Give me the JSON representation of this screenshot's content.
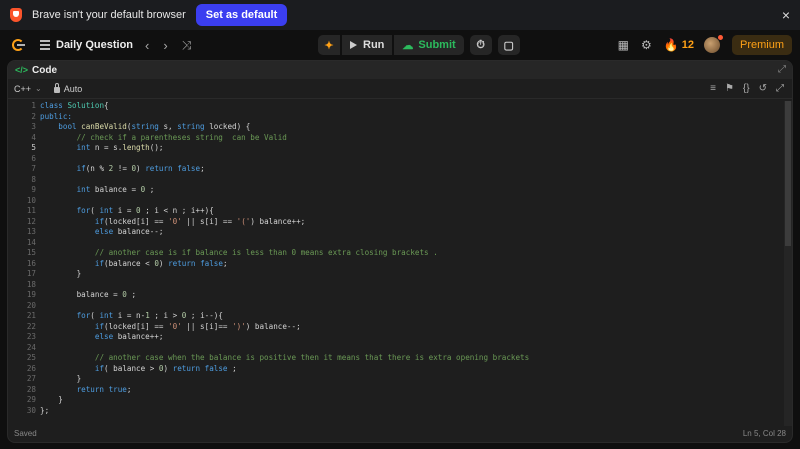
{
  "browser_bar": {
    "message": "Brave isn't your default browser",
    "set_default_label": "Set as default",
    "close": "×"
  },
  "nav": {
    "title": "Daily Question",
    "run_label": "Run",
    "submit_label": "Submit",
    "streak": "12",
    "premium_label": "Premium"
  },
  "editor": {
    "panel_title": "Code",
    "language": "C++",
    "mode": "Auto",
    "status_left": "Saved",
    "status_right": "Ln 5, Col 28",
    "active_line": 5,
    "lines": [
      [
        [
          "kw",
          "class "
        ],
        [
          "cls",
          "Solution"
        ],
        [
          "",
          "{"
        ]
      ],
      [
        [
          "kw",
          "public:"
        ]
      ],
      [
        [
          "",
          "    "
        ],
        [
          "kw",
          "bool "
        ],
        [
          "fn",
          "canBeValid"
        ],
        [
          "",
          "("
        ],
        [
          "kw",
          "string "
        ],
        [
          "",
          "s, "
        ],
        [
          "kw",
          "string "
        ],
        [
          "",
          "locked) {"
        ]
      ],
      [
        [
          "",
          "        "
        ],
        [
          "cm",
          "// check if a parentheses string  can be Valid"
        ]
      ],
      [
        [
          "",
          "        "
        ],
        [
          "kw",
          "int "
        ],
        [
          "",
          "n = s."
        ],
        [
          "fn",
          "length"
        ],
        [
          "",
          "();"
        ]
      ],
      [
        [
          "",
          ""
        ]
      ],
      [
        [
          "",
          "        "
        ],
        [
          "kw",
          "if"
        ],
        [
          "",
          "(n % "
        ],
        [
          "num",
          "2"
        ],
        [
          "",
          " != "
        ],
        [
          "num",
          "0"
        ],
        [
          "",
          ") "
        ],
        [
          "kw",
          "return false"
        ],
        [
          "",
          ";"
        ]
      ],
      [
        [
          "",
          ""
        ]
      ],
      [
        [
          "",
          "        "
        ],
        [
          "kw",
          "int "
        ],
        [
          "",
          "balance = "
        ],
        [
          "num",
          "0"
        ],
        [
          "",
          " ;"
        ]
      ],
      [
        [
          "",
          ""
        ]
      ],
      [
        [
          "",
          "        "
        ],
        [
          "kw",
          "for"
        ],
        [
          "",
          "( "
        ],
        [
          "kw",
          "int "
        ],
        [
          "",
          "i = "
        ],
        [
          "num",
          "0"
        ],
        [
          "",
          " ; i < n ; i++){"
        ]
      ],
      [
        [
          "",
          "            "
        ],
        [
          "kw",
          "if"
        ],
        [
          "",
          "(locked[i] == "
        ],
        [
          "str",
          "'0'"
        ],
        [
          "",
          " || s[i] == "
        ],
        [
          "str",
          "'('"
        ],
        [
          "",
          ") balance++;"
        ]
      ],
      [
        [
          "",
          "            "
        ],
        [
          "kw",
          "else "
        ],
        [
          "",
          "balance--;"
        ]
      ],
      [
        [
          "",
          ""
        ]
      ],
      [
        [
          "",
          "            "
        ],
        [
          "cm",
          "// another case is if balance is less than 0 means extra closing brackets ."
        ]
      ],
      [
        [
          "",
          "            "
        ],
        [
          "kw",
          "if"
        ],
        [
          "",
          "(balance < "
        ],
        [
          "num",
          "0"
        ],
        [
          "",
          ") "
        ],
        [
          "kw",
          "return false"
        ],
        [
          "",
          ";"
        ]
      ],
      [
        [
          "",
          "        }"
        ]
      ],
      [
        [
          "",
          ""
        ]
      ],
      [
        [
          "",
          "        balance = "
        ],
        [
          "num",
          "0"
        ],
        [
          "",
          " ;"
        ]
      ],
      [
        [
          "",
          ""
        ]
      ],
      [
        [
          "",
          "        "
        ],
        [
          "kw",
          "for"
        ],
        [
          "",
          "( "
        ],
        [
          "kw",
          "int "
        ],
        [
          "",
          "i = n-"
        ],
        [
          "num",
          "1"
        ],
        [
          "",
          " ; i > "
        ],
        [
          "num",
          "0"
        ],
        [
          "",
          " ; i--){"
        ]
      ],
      [
        [
          "",
          "            "
        ],
        [
          "kw",
          "if"
        ],
        [
          "",
          "(locked[i] == "
        ],
        [
          "str",
          "'0'"
        ],
        [
          "",
          " || s[i]== "
        ],
        [
          "str",
          "')'"
        ],
        [
          "",
          ") balance--;"
        ]
      ],
      [
        [
          "",
          "            "
        ],
        [
          "kw",
          "else "
        ],
        [
          "",
          "balance++;"
        ]
      ],
      [
        [
          "",
          ""
        ]
      ],
      [
        [
          "",
          "            "
        ],
        [
          "cm",
          "// another case when the balance is positive then it means that there is extra opening brackets"
        ]
      ],
      [
        [
          "",
          "            "
        ],
        [
          "kw",
          "if"
        ],
        [
          "",
          "( balance > "
        ],
        [
          "num",
          "0"
        ],
        [
          "",
          ") "
        ],
        [
          "kw",
          "return false "
        ],
        [
          "",
          ";"
        ]
      ],
      [
        [
          "",
          "        }"
        ]
      ],
      [
        [
          "",
          "        "
        ],
        [
          "kw",
          "return true"
        ],
        [
          "",
          ";"
        ]
      ],
      [
        [
          "",
          "    }"
        ]
      ],
      [
        [
          "",
          "};"
        ]
      ]
    ]
  },
  "colors": {
    "accent": "#ffa116",
    "submit": "#2cbb5d",
    "brave_button": "#3b3ef0"
  }
}
